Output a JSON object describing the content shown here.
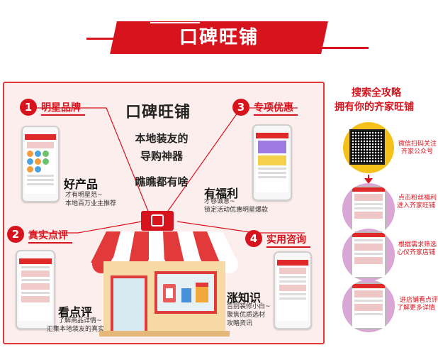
{
  "header": {
    "title": "口碑旺铺"
  },
  "center": {
    "title": "口碑旺铺",
    "sub1": "本地装友的",
    "sub2": "导购神器",
    "sub3": "瞧瞧都有啥"
  },
  "sections": [
    {
      "number": "1",
      "label": "明星品牌",
      "feature": "好产品",
      "desc1": "才有明星范~",
      "desc2": "本地百万业主推荐"
    },
    {
      "number": "2",
      "label": "真实点评",
      "feature": "看点评",
      "desc1": "了解商品详情~",
      "desc2": "汇集本地装友的真实评价"
    },
    {
      "number": "3",
      "label": "专项优惠",
      "feature": "有福利",
      "desc1": "才够诚意~",
      "desc2": "锁定活动优惠明星爆款"
    },
    {
      "number": "4",
      "label": "实用咨询",
      "feature": "涨知识",
      "desc1": "告别装修小白~",
      "desc2": "聚焦优质选材",
      "desc3": "攻略资讯"
    }
  ],
  "guide": {
    "title1": "搜索全攻略",
    "title2": "拥有你的齐家旺铺",
    "steps": [
      {
        "line1": "微信扫码关注",
        "line2": "齐家公众号"
      },
      {
        "line1": "点击粉丝福利",
        "line2": "进入齐家旺铺"
      },
      {
        "line1": "根据需求筛选",
        "line2": "心仪齐家店铺"
      },
      {
        "line1": "进店铺看点评",
        "line2": "了解更多详情"
      }
    ]
  },
  "colors": {
    "brand_red": "#d7141d",
    "panel_bg": "#fdeeee",
    "guide_circle": "#d9a6d6",
    "qr_ring": "#f4c01a"
  }
}
